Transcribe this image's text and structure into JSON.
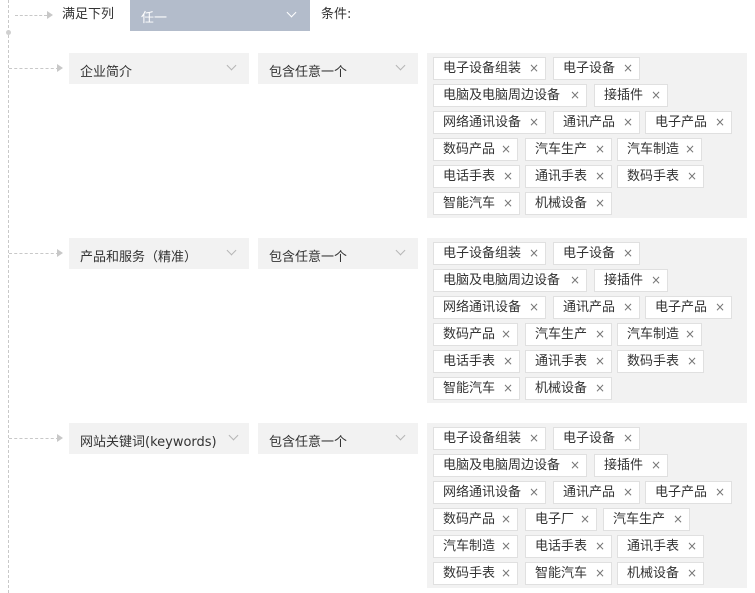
{
  "header": {
    "match_prefix": "满足下列",
    "match_value": "任一",
    "condition_label": "条件:"
  },
  "rules": [
    {
      "field": "企业简介",
      "operator": "包含任意一个",
      "tags": [
        "电子设备组装",
        "电子设备",
        "电脑及电脑周边设备",
        "接插件",
        "网络通讯设备",
        "通讯产品",
        "电子产品",
        "数码产品",
        "汽车生产",
        "汽车制造",
        "电话手表",
        "通讯手表",
        "数码手表",
        "智能汽车",
        "机械设备"
      ]
    },
    {
      "field": "产品和服务（精准）",
      "operator": "包含任意一个",
      "tags": [
        "电子设备组装",
        "电子设备",
        "电脑及电脑周边设备",
        "接插件",
        "网络通讯设备",
        "通讯产品",
        "电子产品",
        "数码产品",
        "汽车生产",
        "汽车制造",
        "电话手表",
        "通讯手表",
        "数码手表",
        "智能汽车",
        "机械设备"
      ]
    },
    {
      "field": "网站关键词(keywords)",
      "operator": "包含任意一个",
      "tags": [
        "电子设备组装",
        "电子设备",
        "电脑及电脑周边设备",
        "接插件",
        "网络通讯设备",
        "通讯产品",
        "电子产品",
        "数码产品",
        "电子厂",
        "汽车生产",
        "汽车制造",
        "电话手表",
        "通讯手表",
        "数码手表",
        "智能汽车",
        "机械设备"
      ]
    }
  ],
  "remove_glyph": "×",
  "icons": {
    "dropdown": "chevron-down-icon",
    "remove": "close-icon"
  }
}
